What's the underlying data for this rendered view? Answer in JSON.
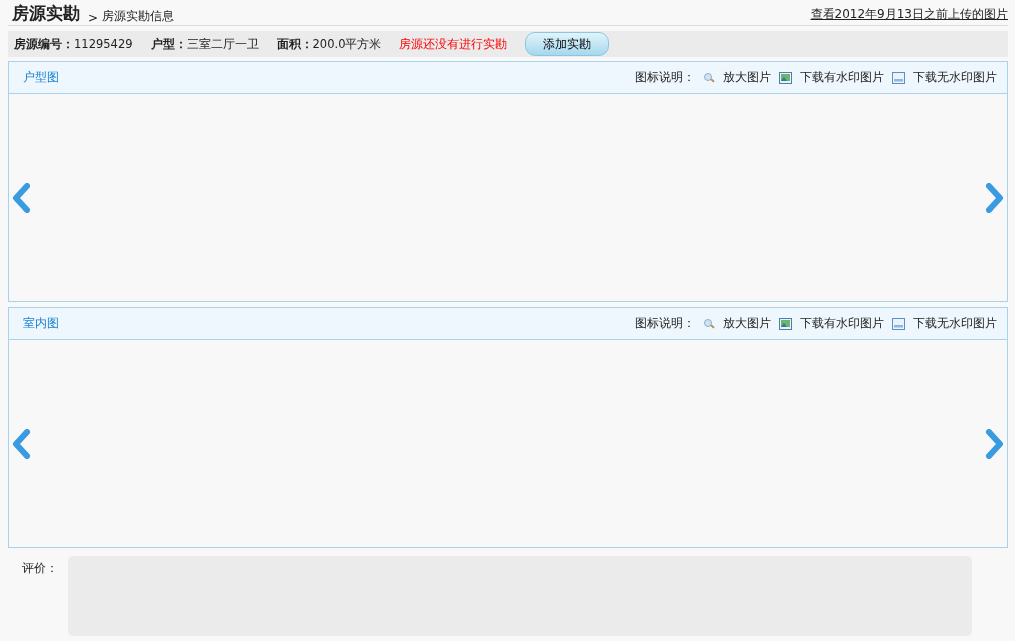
{
  "header": {
    "title": "房源实勘",
    "breadcrumb_separator": ">",
    "subtitle": "房源实勘信息",
    "history_link": "查看2012年9月13日之前上传的图片"
  },
  "info": {
    "fields": [
      {
        "label": "房源编号：",
        "value": "11295429"
      },
      {
        "label": "户型：",
        "value": "三室二厅一卫"
      },
      {
        "label": "面积：",
        "value": "200.0平方米"
      }
    ],
    "status": "房源还没有进行实勘",
    "add_button": "添加实勘"
  },
  "sections": [
    {
      "title": "户型图",
      "legend_label": "图标说明：",
      "legend": [
        {
          "kind": "zoom",
          "label": "放大图片"
        },
        {
          "kind": "watermark",
          "label": "下载有水印图片"
        },
        {
          "kind": "plain",
          "label": "下载无水印图片"
        }
      ]
    },
    {
      "title": "室内图",
      "legend_label": "图标说明：",
      "legend": [
        {
          "kind": "zoom",
          "label": "放大图片"
        },
        {
          "kind": "watermark",
          "label": "下载有水印图片"
        },
        {
          "kind": "plain",
          "label": "下载无水印图片"
        }
      ]
    }
  ],
  "comment": {
    "label": "评价："
  }
}
